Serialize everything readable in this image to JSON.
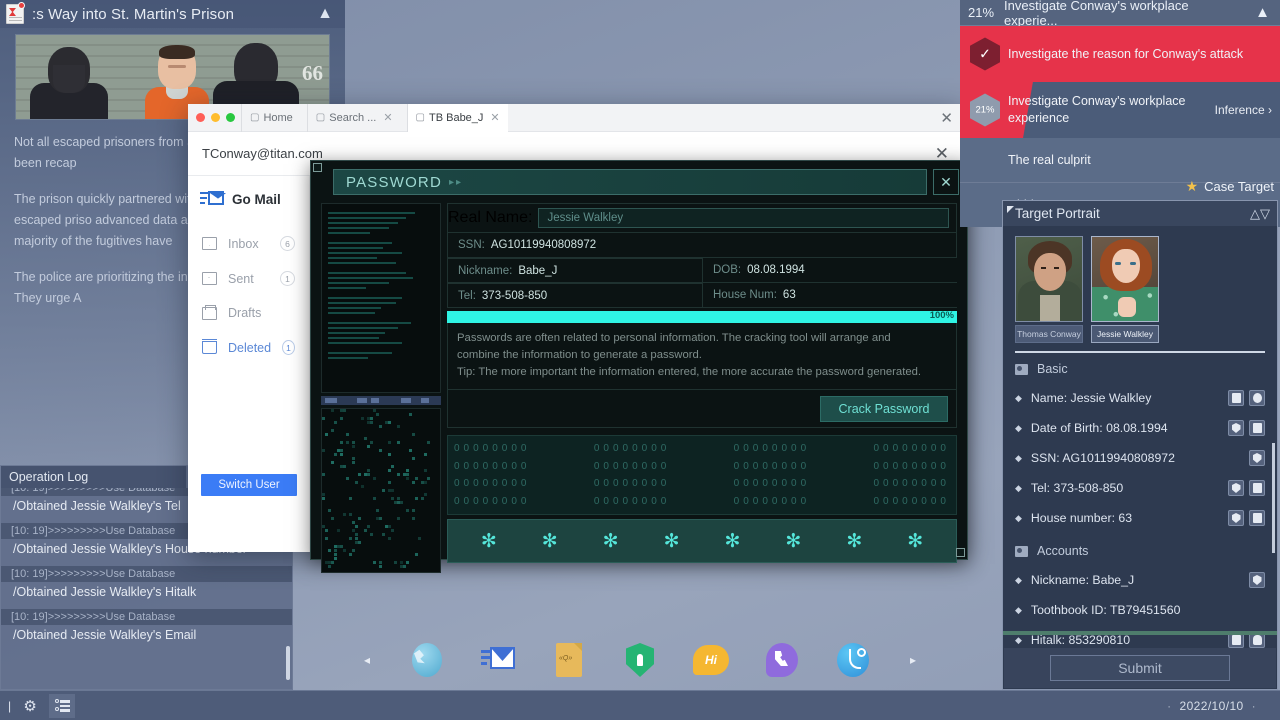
{
  "news": {
    "title": ":s Way into St. Martin's Prison",
    "collapse_icon": "chevron-up",
    "paragraphs": [
      "Not all escaped prisoners from St northern Aridru have been recap",
      "The prison quickly partnered with AI system to locate escaped priso advanced data aggregation and the majority of the fugitives have",
      "The police are prioritizing the inte supervision system. They urge A"
    ],
    "photo_number": "66"
  },
  "oplog": {
    "title": "Operation Log",
    "entries": [
      {
        "ts": "[10: 19]>>>>>>>>>Use Database",
        "msg": "/Obtained Jessie Walkley's Tel"
      },
      {
        "ts": "[10: 19]>>>>>>>>>Use Database",
        "msg": "/Obtained Jessie Walkley's House number"
      },
      {
        "ts": "[10: 19]>>>>>>>>>Use Database",
        "msg": "/Obtained Jessie Walkley's Hitalk"
      },
      {
        "ts": "[10: 19]>>>>>>>>>Use Database",
        "msg": "/Obtained Jessie Walkley's Email"
      }
    ]
  },
  "mail": {
    "tabs": [
      {
        "label": "Home",
        "closable": false
      },
      {
        "label": "Search ...",
        "closable": true
      },
      {
        "label": "TB Babe_J",
        "closable": true
      }
    ],
    "close_label": "✕",
    "address": "TConway@titan.com",
    "address_close": "✕",
    "brand": "Go Mail",
    "nav": [
      {
        "label": "Inbox",
        "count": "6",
        "icon": "envelope-icon"
      },
      {
        "label": "Sent",
        "count": "1",
        "icon": "sent-icon"
      },
      {
        "label": "Drafts",
        "count": "",
        "icon": "drafts-icon"
      },
      {
        "label": "Deleted",
        "count": "1",
        "icon": "trash-icon"
      }
    ],
    "switch_user": "Switch User"
  },
  "crack": {
    "title": "PASSWORD",
    "title_arrows": "▸▸",
    "close": "✕",
    "real_name_label": "Real Name:",
    "real_name_value": "Jessie Walkley",
    "fields": [
      {
        "label": "SSN:",
        "value": "AG10119940808972"
      },
      {
        "label": "Nickname:",
        "value": "Babe_J"
      },
      {
        "label": "DOB:",
        "value": "08.08.1994"
      },
      {
        "label": "Tel:",
        "value": "373-508-850"
      },
      {
        "label": "House Num:",
        "value": "63"
      }
    ],
    "progress_pct": "100%",
    "progress_value": 100,
    "tip_line1": "Passwords are often related to personal information. The cracking tool will arrange and",
    "tip_line2": "combine the information to generate a password.",
    "tip_line3": "Tip: The more important the information entered, the more accurate the password generated.",
    "crack_button": "Crack Password",
    "zero_group": "00000000",
    "zero_rows": 4,
    "zero_cols": 4,
    "stars": "✻",
    "star_count": 8
  },
  "investigation": {
    "header_pct": "21%",
    "header_title": "Investigate Conway's workplace experie...",
    "header_chevron": "«",
    "rows": [
      {
        "badge": "done",
        "badge_text": "",
        "text": "Investigate the reason for Conway's attack",
        "action": ""
      },
      {
        "badge": "pct",
        "badge_text": "21%",
        "text": "Investigate Conway's workplace experience",
        "action": "Inference ›"
      },
      {
        "badge": "none",
        "badge_text": "",
        "text": "The real culprit",
        "action": ""
      },
      {
        "badge": "none",
        "badge_text": "",
        "text": "Hidden secrets",
        "action": ""
      }
    ]
  },
  "case_target": {
    "label": "Case Target",
    "star": "★"
  },
  "portrait": {
    "panel_title": "Target Portrait",
    "expand_icon": "expand-icon",
    "faces": [
      {
        "name": "Thomas Conway",
        "selected": false
      },
      {
        "name": "Jessie Walkley",
        "selected": true
      }
    ],
    "sections": [
      {
        "title": "Basic",
        "rows": [
          {
            "text": "Name: Jessie Walkley",
            "chips": [
              "doc",
              "globe"
            ]
          },
          {
            "text": "Date of Birth: 08.08.1994",
            "chips": [
              "shield",
              "doc"
            ]
          },
          {
            "text": "SSN: AG10119940808972",
            "chips": [
              "shield"
            ]
          },
          {
            "text": "Tel: 373-508-850",
            "chips": [
              "shield",
              "doc"
            ]
          },
          {
            "text": "House number: 63",
            "chips": [
              "shield",
              "doc"
            ]
          }
        ]
      },
      {
        "title": "Accounts",
        "rows": [
          {
            "text": "Nickname: Babe_J",
            "chips": [
              "shield"
            ]
          },
          {
            "text": "Toothbook ID: TB79451560",
            "chips": []
          },
          {
            "text": "Hitalk: 853290810",
            "chips": [
              "doc",
              "msg"
            ]
          }
        ]
      }
    ],
    "submit": "Submit"
  },
  "dock": {
    "prev": "◂",
    "next": "▸",
    "items": [
      {
        "name": "browser-icon",
        "label": "Browser"
      },
      {
        "name": "mail-icon",
        "label": "Go Mail"
      },
      {
        "name": "file-icon",
        "label": "Files"
      },
      {
        "name": "shield-icon",
        "label": "Security"
      },
      {
        "name": "hi-icon",
        "label": "Hi",
        "text": "Hi"
      },
      {
        "name": "phone-icon",
        "label": "Phone"
      },
      {
        "name": "hook-icon",
        "label": "Hook"
      }
    ]
  },
  "bottombar": {
    "gear_icon": "gear-icon",
    "list_icon": "list-icon",
    "date": "2022/10/10",
    "dot": "·"
  },
  "colors": {
    "accent_red": "#e6334a",
    "accent_cyan": "#2ff4e4",
    "accent_blue": "#3b7cf6",
    "panel_dark": "#2e3a50"
  }
}
